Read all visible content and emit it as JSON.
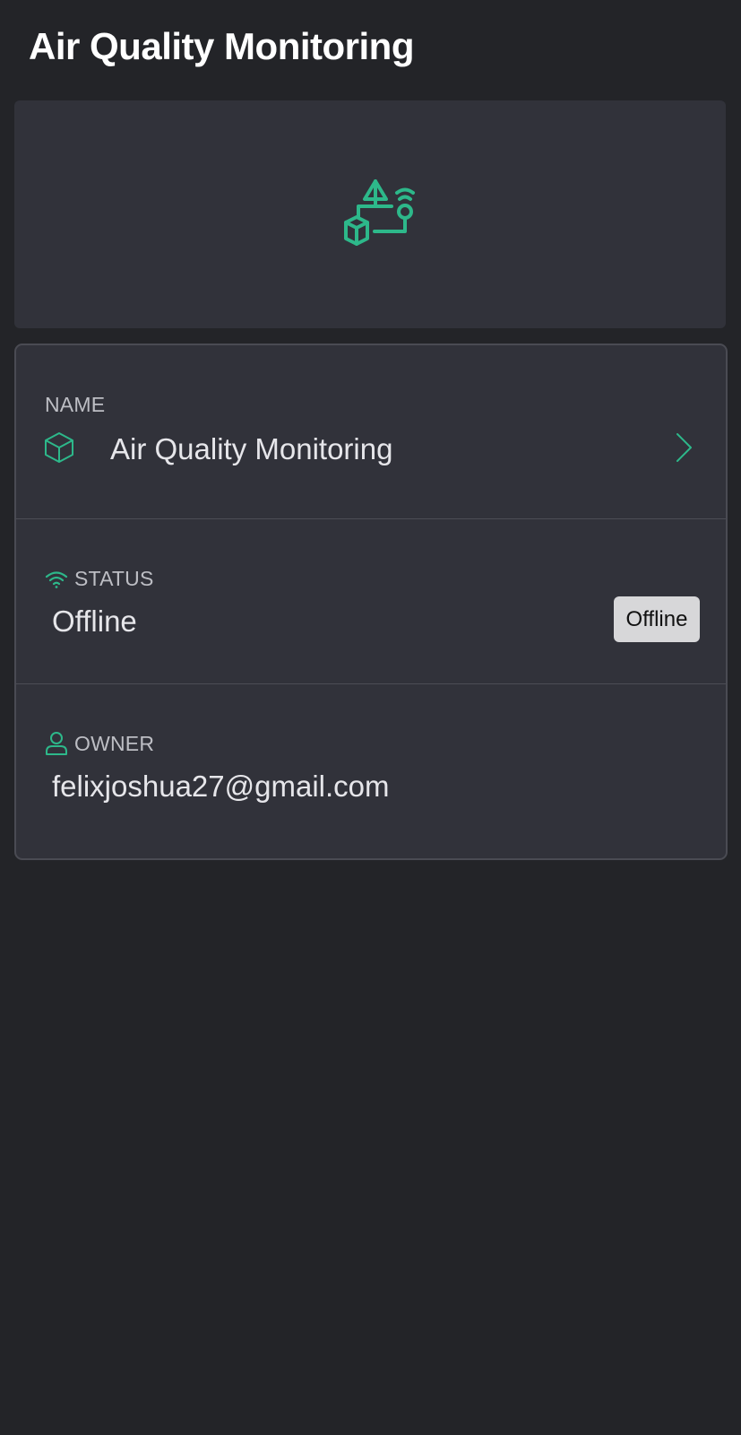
{
  "header": {
    "title": "Air Quality Monitoring"
  },
  "hero": {
    "icon": "iot-device-network-icon",
    "accent_color": "#2DB88A"
  },
  "details": {
    "name": {
      "label": "NAME",
      "value": "Air Quality Monitoring",
      "icon": "cube-icon",
      "action_icon": "chevron-right-icon"
    },
    "status": {
      "label": "STATUS",
      "value": "Offline",
      "badge": "Offline",
      "icon": "wifi-icon"
    },
    "owner": {
      "label": "OWNER",
      "value": "felixjoshua27@gmail.com",
      "icon": "user-icon"
    }
  },
  "colors": {
    "background": "#232428",
    "card": "#31323A",
    "accent": "#2DB88A",
    "badge_bg": "#D7D7D9"
  }
}
